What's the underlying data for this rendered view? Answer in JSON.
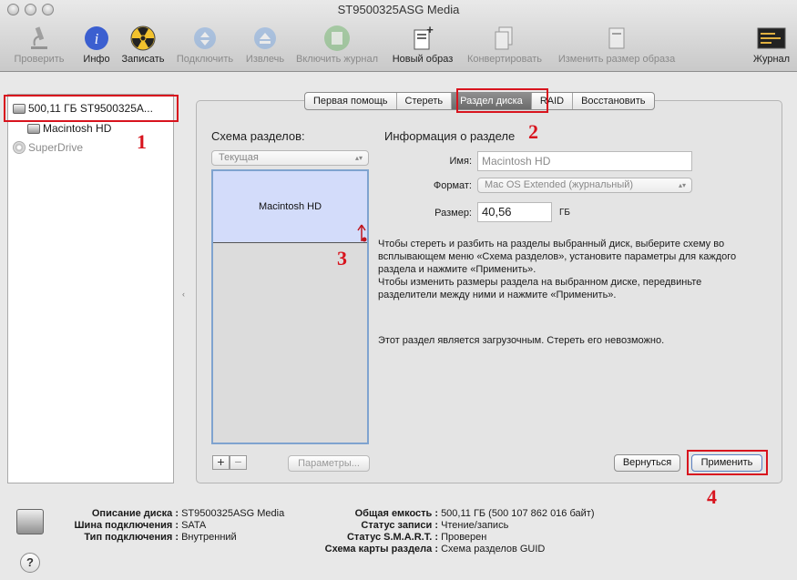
{
  "window": {
    "title": "ST9500325ASG Media"
  },
  "toolbar": {
    "verify": "Проверить",
    "info": "Инфо",
    "burn": "Записать",
    "mount": "Подключить",
    "eject": "Извлечь",
    "journal": "Включить журнал",
    "new_image": "Новый образ",
    "convert": "Конвертировать",
    "resize": "Изменить размер образа",
    "log": "Журнал"
  },
  "sidebar": {
    "items": [
      {
        "label": "500,11 ГБ ST9500325A..."
      },
      {
        "label": "Macintosh HD"
      },
      {
        "label": "SuperDrive"
      }
    ]
  },
  "tabs": [
    "Первая помощь",
    "Стереть",
    "Раздел диска",
    "RAID",
    "Восстановить"
  ],
  "partition": {
    "scheme_title": "Схема разделов:",
    "scheme_value": "Текущая",
    "partition_name": "Macintosh HD",
    "info_title": "Информация о разделе",
    "name_label": "Имя:",
    "name_value": "Macintosh HD",
    "format_label": "Формат:",
    "format_value": "Mac OS Extended (журнальный)",
    "size_label": "Размер:",
    "size_value": "40,56",
    "size_unit": "ГБ",
    "help_lines": [
      "Чтобы стереть и разбить на разделы выбранный диск, выберите схему во",
      "всплывающем меню «Схема разделов», установите параметры для каждого",
      "раздела и нажмите «Применить».",
      "Чтобы изменить размеры раздела на выбранном диске, передвиньте",
      "разделители между ними и нажмите «Применить»."
    ],
    "note": "Этот раздел является загрузочным. Стереть его невозможно.",
    "add": "+",
    "remove": "−",
    "options": "Параметры...",
    "revert": "Вернуться",
    "apply": "Применить"
  },
  "annotations": [
    "1",
    "2",
    "3",
    "4"
  ],
  "footer": {
    "left": [
      {
        "k": "Описание диска :",
        "v": "ST9500325ASG Media"
      },
      {
        "k": "Шина подключения :",
        "v": "SATA"
      },
      {
        "k": "Тип подключения :",
        "v": "Внутренний"
      }
    ],
    "right": [
      {
        "k": "Общая емкость :",
        "v": "500,11 ГБ (500 107 862 016 байт)"
      },
      {
        "k": "Статус записи :",
        "v": "Чтение/запись"
      },
      {
        "k": "Статус S.M.A.R.T. :",
        "v": "Проверен"
      },
      {
        "k": "Схема карты раздела :",
        "v": "Схема разделов GUID"
      }
    ],
    "help": "?"
  },
  "colors": {
    "highlight": "#d8141e",
    "partition_fill": "#d3dcfa",
    "selected_tab": "#7a7a7a"
  }
}
